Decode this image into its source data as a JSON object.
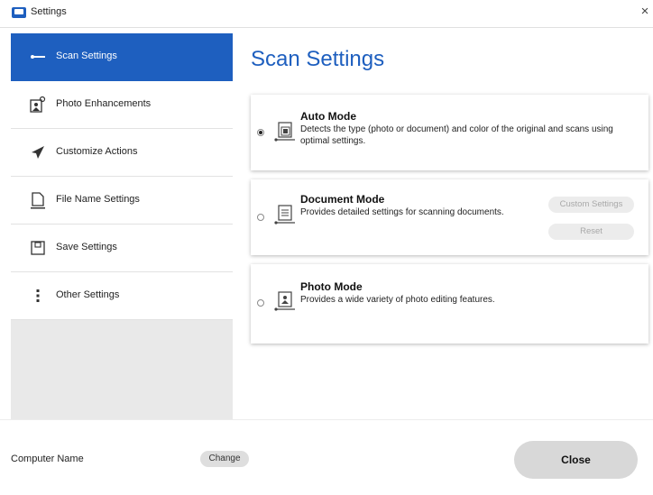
{
  "window": {
    "title": "Settings",
    "close_glyph": "×"
  },
  "sidebar": {
    "items": [
      {
        "label": "Scan Settings",
        "icon": "scan-icon",
        "active": true
      },
      {
        "label": "Photo Enhancements",
        "icon": "photo-enhance-icon",
        "active": false
      },
      {
        "label": "Customize Actions",
        "icon": "send-icon",
        "active": false
      },
      {
        "label": "File Name Settings",
        "icon": "file-icon",
        "active": false
      },
      {
        "label": "Save Settings",
        "icon": "save-icon",
        "active": false
      },
      {
        "label": "Other Settings",
        "icon": "more-vertical-icon",
        "active": false
      }
    ]
  },
  "main": {
    "title": "Scan Settings",
    "modes": [
      {
        "name": "Auto Mode",
        "description": "Detects the type (photo or document) and color of the original and scans using optimal settings.",
        "selected": true,
        "icon": "auto-mode-icon"
      },
      {
        "name": "Document Mode",
        "description": "Provides detailed settings for scanning documents.",
        "selected": false,
        "icon": "document-mode-icon",
        "buttons": {
          "custom_settings": "Custom Settings",
          "reset": "Reset"
        }
      },
      {
        "name": "Photo Mode",
        "description": "Provides a wide variety of photo editing features.",
        "selected": false,
        "icon": "photo-mode-icon"
      }
    ]
  },
  "footer": {
    "computer_name_label": "Computer Name",
    "change_label": "Change",
    "close_label": "Close"
  },
  "colors": {
    "accent": "#1e5fbf",
    "sidebar_bg": "#e9e9e9",
    "button_bg": "#d8d8d8"
  }
}
